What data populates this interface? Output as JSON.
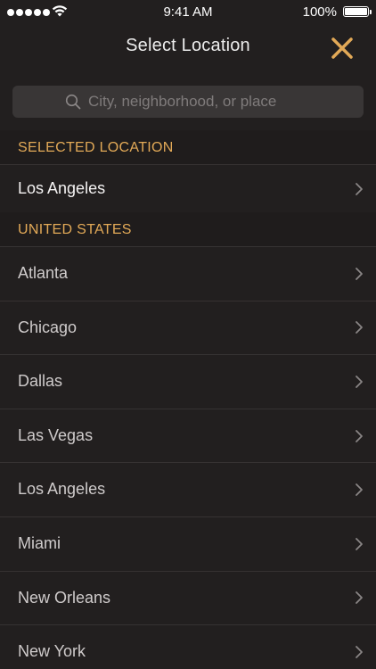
{
  "status_bar": {
    "time": "9:41 AM",
    "battery_percent": "100%",
    "battery_level": 1.0,
    "signal_icon": "signal-dots-icon",
    "wifi_icon": "wifi-icon"
  },
  "header": {
    "title": "Select Location",
    "close_icon": "close-x-icon"
  },
  "search": {
    "placeholder": "City, neighborhood, or place",
    "value": "",
    "icon": "search-icon"
  },
  "sections": {
    "selected": {
      "header": "SELECTED LOCATION",
      "items": [
        "Los Angeles"
      ]
    },
    "united_states": {
      "header": "UNITED STATES",
      "items": [
        "Atlanta",
        "Chicago",
        "Dallas",
        "Las Vegas",
        "Los Angeles",
        "Miami",
        "New Orleans",
        "New York"
      ]
    }
  },
  "colors": {
    "background": "#221f1f",
    "accent": "#e2a957",
    "text": "#cfcbcb",
    "search_field": "#393636"
  }
}
